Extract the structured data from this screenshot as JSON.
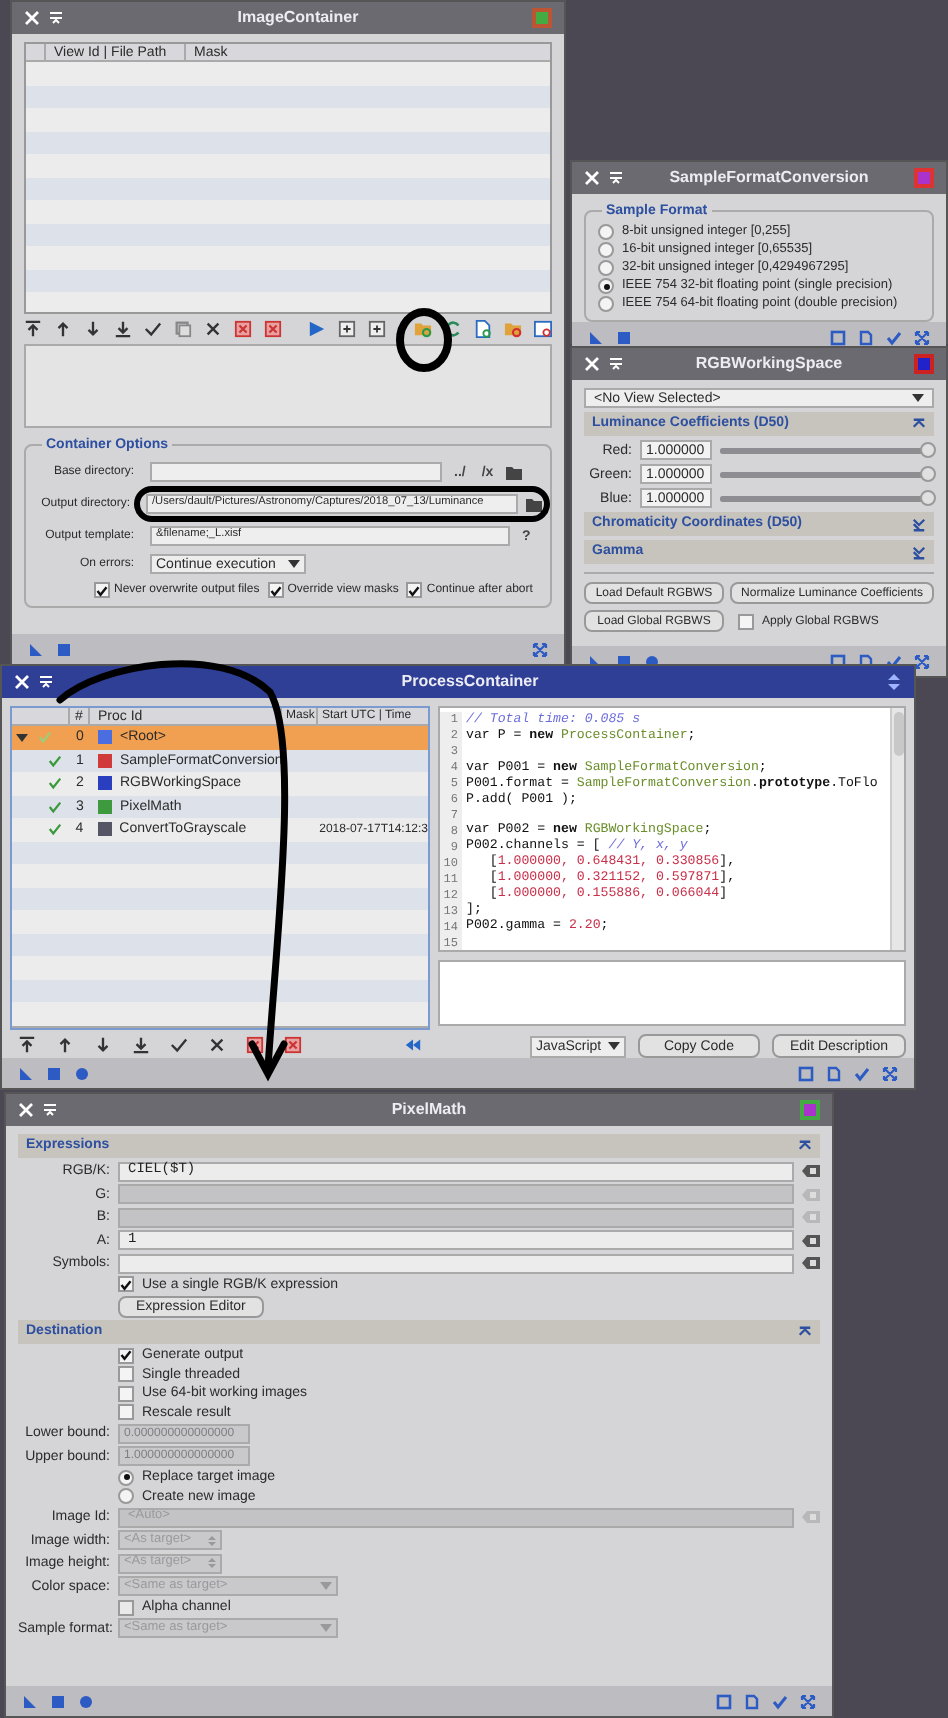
{
  "image_container": {
    "title": "ImageContainer",
    "columns": [
      "View Id | File Path",
      "Mask"
    ],
    "options_title": "Container Options",
    "fields": [
      {
        "label": "Base directory:",
        "kind": "base",
        "extras": [
          "../",
          "/x"
        ]
      },
      {
        "label": "Output directory:",
        "kind": "dir",
        "value": "/Users/dault/Pictures/Astronomy/Captures/2018_07_13/Luminance"
      },
      {
        "label": "Output template:",
        "kind": "template",
        "value": "&filename;_L.xisf",
        "extras": [
          "?"
        ]
      }
    ],
    "on_errors": {
      "label": "On errors:",
      "value": "Continue execution"
    },
    "checks": [
      {
        "label": "Never overwrite output files",
        "checked": true
      },
      {
        "label": "Override view masks",
        "checked": true
      },
      {
        "label": "Continue after abort",
        "checked": true
      }
    ]
  },
  "sample_format": {
    "title": "SampleFormatConversion",
    "group_title": "Sample Format",
    "options": [
      {
        "label": "8-bit unsigned integer [0,255]",
        "selected": false
      },
      {
        "label": "16-bit unsigned integer [0,65535]",
        "selected": false
      },
      {
        "label": "32-bit unsigned integer [0,4294967295]",
        "selected": false
      },
      {
        "label": "IEEE 754 32-bit floating point (single precision)",
        "selected": true
      },
      {
        "label": "IEEE 754 64-bit floating point (double precision)",
        "selected": false
      }
    ]
  },
  "rgb_working_space": {
    "title": "RGBWorkingSpace",
    "view": "<No View Selected>",
    "sections": [
      {
        "title": "Luminance Coefficients (D50)",
        "expanded": true
      },
      {
        "title": "Chromaticity Coordinates (D50)",
        "expanded": false
      },
      {
        "title": "Gamma",
        "expanded": false
      }
    ],
    "coefficients": [
      {
        "label": "Red:",
        "value": "1.000000",
        "level": 1
      },
      {
        "label": "Green:",
        "value": "1.000000",
        "level": 1
      },
      {
        "label": "Blue:",
        "value": "1.000000",
        "level": 1
      }
    ],
    "buttons": [
      "Load Default RGBWS",
      "Normalize Luminance Coefficients",
      "Load Global RGBWS"
    ],
    "apply_global": {
      "label": "Apply Global RGBWS",
      "checked": false
    }
  },
  "process_container": {
    "title": "ProcessContainer",
    "columns": [
      "#",
      "Proc Id",
      "Mask",
      "Start UTC | Time"
    ],
    "rows": [
      {
        "index": "0",
        "name": "<Root>",
        "checked": true,
        "expanded": true,
        "selected": true,
        "color": "#4a6ee0",
        "children": [
          {
            "index": "1",
            "name": "SampleFormatConversion",
            "checked": true,
            "selected": false,
            "color": "#d03a3a"
          },
          {
            "index": "2",
            "name": "RGBWorkingSpace",
            "checked": true,
            "selected": false,
            "color": "#2a3fc0"
          },
          {
            "index": "3",
            "name": "PixelMath",
            "checked": true,
            "selected": false,
            "color": "#3f9a3f"
          },
          {
            "index": "4",
            "name": "ConvertToGrayscale",
            "checked": true,
            "selected": false,
            "color": "#555566",
            "time": "2018-07-17T14:12:3"
          }
        ]
      }
    ],
    "code": [
      {
        "n": "1",
        "tokens": [
          {
            "kind": "comment",
            "text": "// Total time: 0.085 s"
          }
        ]
      },
      {
        "n": "2",
        "tokens": [
          {
            "kind": "plain",
            "text": "var P = "
          },
          {
            "kind": "keyword",
            "text": "new "
          },
          {
            "kind": "class",
            "text": "ProcessContainer"
          },
          {
            "kind": "plain",
            "text": ";"
          }
        ]
      },
      {
        "n": "3"
      },
      {
        "n": "4",
        "tokens": [
          {
            "kind": "plain",
            "text": "var P001 = "
          },
          {
            "kind": "keyword",
            "text": "new "
          },
          {
            "kind": "class",
            "text": "SampleFormatConversion"
          },
          {
            "kind": "plain",
            "text": ";"
          }
        ]
      },
      {
        "n": "5",
        "tokens": [
          {
            "kind": "plain",
            "text": "P001.format = "
          },
          {
            "kind": "class",
            "text": "SampleFormatConversion"
          },
          {
            "kind": "plain",
            "text": "."
          },
          {
            "kind": "keyword",
            "text": "prototype"
          },
          {
            "kind": "plain",
            "text": ".ToFlo"
          }
        ]
      },
      {
        "n": "6",
        "tokens": [
          {
            "kind": "plain",
            "text": "P.add( P001 );"
          }
        ]
      },
      {
        "n": "7"
      },
      {
        "n": "8",
        "tokens": [
          {
            "kind": "plain",
            "text": "var P002 = "
          },
          {
            "kind": "keyword",
            "text": "new "
          },
          {
            "kind": "class",
            "text": "RGBWorkingSpace"
          },
          {
            "kind": "plain",
            "text": ";"
          }
        ]
      },
      {
        "n": "9",
        "tokens": [
          {
            "kind": "plain",
            "text": "P002.channels = [ "
          },
          {
            "kind": "comment",
            "text": "// Y, x, y"
          }
        ]
      },
      {
        "n": "10",
        "tokens": [
          {
            "kind": "plain",
            "text": "   ["
          },
          {
            "kind": "number",
            "text": "1.000000, 0.648431, 0.330856"
          },
          {
            "kind": "plain",
            "text": "],"
          }
        ]
      },
      {
        "n": "11",
        "tokens": [
          {
            "kind": "plain",
            "text": "   ["
          },
          {
            "kind": "number",
            "text": "1.000000, 0.321152, 0.597871"
          },
          {
            "kind": "plain",
            "text": "],"
          }
        ]
      },
      {
        "n": "12",
        "tokens": [
          {
            "kind": "plain",
            "text": "   ["
          },
          {
            "kind": "number",
            "text": "1.000000, 0.155886, 0.066044"
          },
          {
            "kind": "plain",
            "text": "]"
          }
        ]
      },
      {
        "n": "13",
        "tokens": [
          {
            "kind": "plain",
            "text": "];"
          }
        ]
      },
      {
        "n": "14",
        "tokens": [
          {
            "kind": "plain",
            "text": "P002.gamma = "
          },
          {
            "kind": "number",
            "text": "2.20"
          },
          {
            "kind": "plain",
            "text": ";"
          }
        ]
      },
      {
        "n": "15"
      }
    ],
    "language": "JavaScript",
    "buttons": [
      "Copy Code",
      "Edit Description"
    ]
  },
  "pixel_math": {
    "title": "PixelMath",
    "sections": [
      {
        "title": "Expressions",
        "expanded": true
      },
      {
        "title": "Destination",
        "expanded": true
      }
    ],
    "expressions": [
      {
        "label": "RGB/K:",
        "value": "CIEL($T)",
        "disabled": false
      },
      {
        "label": "G:",
        "disabled": true
      },
      {
        "label": "B:",
        "disabled": true
      },
      {
        "label": "A:",
        "value": "1",
        "disabled": false
      },
      {
        "label": "Symbols:",
        "disabled": false
      }
    ],
    "single_rgb": {
      "label": "Use a single RGB/K expression",
      "checked": true
    },
    "editor_button": "Expression Editor",
    "options": [
      {
        "label": "Generate output",
        "checked": true
      },
      {
        "label": "Single threaded",
        "checked": false
      },
      {
        "label": "Use 64-bit working images",
        "checked": false
      },
      {
        "label": "Rescale result",
        "checked": false
      }
    ],
    "bounds": [
      {
        "label": "Lower bound:",
        "value": "0.000000000000000"
      },
      {
        "label": "Upper bound:",
        "value": "1.000000000000000"
      }
    ],
    "targets": [
      {
        "label": "Replace target image",
        "selected": true
      },
      {
        "label": "Create new image",
        "selected": false
      }
    ],
    "image_fields": [
      {
        "kind": "text",
        "label": "Image Id:",
        "placeholder": "<Auto>"
      },
      {
        "kind": "spin",
        "label": "Image width:",
        "placeholder": "<As target>"
      },
      {
        "kind": "spin",
        "label": "Image height:",
        "placeholder": "<As target>"
      },
      {
        "kind": "select",
        "label": "Color space:",
        "placeholder": "<Same as target>"
      },
      {
        "kind": "check",
        "label": "Alpha channel",
        "checked": false
      },
      {
        "kind": "select",
        "label": "Sample format:",
        "placeholder": "<Same as target>"
      }
    ]
  }
}
